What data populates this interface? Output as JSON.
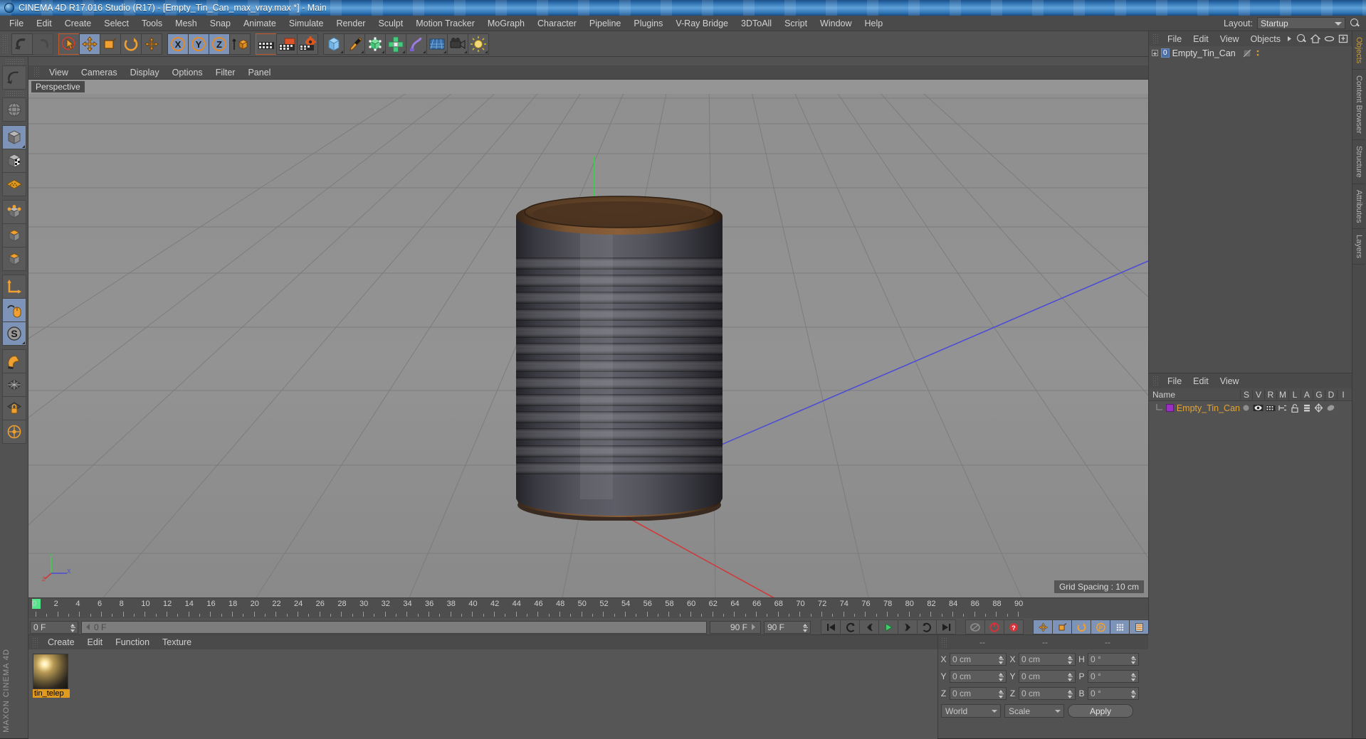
{
  "window": {
    "title": "CINEMA 4D R17.016 Studio (R17) - [Empty_Tin_Can_max_vray.max *] - Main",
    "app_icon": "cinema4d-logo-icon"
  },
  "menubar": {
    "items": [
      "File",
      "Edit",
      "Create",
      "Select",
      "Tools",
      "Mesh",
      "Snap",
      "Animate",
      "Simulate",
      "Render",
      "Sculpt",
      "Motion Tracker",
      "MoGraph",
      "Character",
      "Pipeline",
      "Plugins",
      "V-Ray Bridge",
      "3DToAll",
      "Script",
      "Window",
      "Help"
    ],
    "layout_label": "Layout:",
    "layout_value": "Startup",
    "search_icon": "magnifier-icon"
  },
  "toolbar": {
    "groups": [
      {
        "name": "undo-redo",
        "buttons": [
          {
            "icon": "undo-icon",
            "label": "Undo",
            "state": "normal"
          },
          {
            "icon": "redo-icon",
            "label": "Redo",
            "state": "disabled"
          }
        ]
      },
      {
        "name": "transform-tools",
        "buttons": [
          {
            "icon": "live-selection-icon",
            "label": "Live Selection",
            "state": "active"
          },
          {
            "icon": "move-icon",
            "label": "Move",
            "state": "selected"
          },
          {
            "icon": "scale-icon",
            "label": "Scale",
            "state": "normal"
          },
          {
            "icon": "rotate-icon",
            "label": "Rotate",
            "state": "normal"
          },
          {
            "icon": "move-alt-icon",
            "label": "Move",
            "state": "normal"
          }
        ]
      },
      {
        "name": "axis-locks",
        "buttons": [
          {
            "icon": "x-axis-icon",
            "label": "X Axis",
            "state": "selected"
          },
          {
            "icon": "y-axis-icon",
            "label": "Y Axis",
            "state": "selected"
          },
          {
            "icon": "z-axis-icon",
            "label": "Z Axis",
            "state": "selected"
          },
          {
            "icon": "world-object-axis-icon",
            "label": "World / Object",
            "state": "normal"
          }
        ]
      },
      {
        "name": "render-tools",
        "buttons": [
          {
            "icon": "render-view-icon",
            "label": "Render View",
            "state": "active"
          },
          {
            "icon": "render-region-icon",
            "label": "Render to Picture Viewer",
            "state": "normal"
          },
          {
            "icon": "render-settings-icon",
            "label": "Edit Render Settings",
            "state": "normal"
          }
        ]
      },
      {
        "name": "create-tools",
        "buttons": [
          {
            "icon": "cube-primitive-icon",
            "label": "Add Cube Object",
            "state": "normal"
          },
          {
            "icon": "spline-pen-icon",
            "label": "Pen",
            "state": "normal"
          },
          {
            "icon": "nurbs-icon",
            "label": "Subdivision Surface",
            "state": "normal"
          },
          {
            "icon": "array-icon",
            "label": "Array",
            "state": "normal"
          },
          {
            "icon": "deformer-icon",
            "label": "Bend Deformer",
            "state": "normal"
          },
          {
            "icon": "environment-icon",
            "label": "Floor",
            "state": "normal"
          },
          {
            "icon": "camera-icon",
            "label": "Camera",
            "state": "normal"
          },
          {
            "icon": "light-icon",
            "label": "Light",
            "state": "normal"
          }
        ]
      }
    ]
  },
  "left_toolbar": {
    "buttons": [
      {
        "icon": "undo-arrow-icon",
        "label": "Undo",
        "state": "normal"
      },
      {
        "icon": "globe-wireframe-icon",
        "label": "Make Editable",
        "state": "normal"
      },
      {
        "icon": "model-mode-icon",
        "label": "Model Mode",
        "state": "selected"
      },
      {
        "icon": "texture-mode-icon",
        "label": "Texture Mode",
        "state": "normal"
      },
      {
        "icon": "workplane-icon",
        "label": "Workplane",
        "state": "normal"
      },
      {
        "icon": "points-mode-icon",
        "label": "Points",
        "state": "normal"
      },
      {
        "icon": "edges-mode-icon",
        "label": "Edges",
        "state": "normal"
      },
      {
        "icon": "polygons-mode-icon",
        "label": "Polygons",
        "state": "normal"
      },
      {
        "icon": "axis-modify-icon",
        "label": "Enable Axis Modification",
        "state": "normal"
      },
      {
        "icon": "mouse-viewport-icon",
        "label": "Viewport Solo",
        "state": "selected"
      },
      {
        "icon": "snap-icon",
        "label": "Enable Snapping",
        "state": "selected"
      },
      {
        "icon": "magnet-icon",
        "label": "Magnet",
        "state": "normal"
      },
      {
        "icon": "workplane-grid-icon",
        "label": "Workplane Grid",
        "state": "normal"
      },
      {
        "icon": "lock-workplane-icon",
        "label": "Lock Workplane",
        "state": "normal"
      },
      {
        "icon": "planar-workplane-icon",
        "label": "Planar Workplane",
        "state": "normal"
      }
    ],
    "brand_line1": "MAXON",
    "brand_line2": "CINEMA 4D"
  },
  "viewport": {
    "menu": [
      "View",
      "Cameras",
      "Display",
      "Options",
      "Filter",
      "Panel"
    ],
    "label": "Perspective",
    "grid_spacing": "Grid Spacing : 10 cm",
    "axis_gizmo": {
      "x": "X",
      "y": "Y",
      "z": "Z"
    },
    "object": "tin-can-3d-model"
  },
  "timeline": {
    "ticks": [
      0,
      2,
      4,
      6,
      8,
      10,
      12,
      14,
      16,
      18,
      20,
      22,
      24,
      26,
      28,
      30,
      32,
      34,
      36,
      38,
      40,
      42,
      44,
      46,
      48,
      50,
      52,
      54,
      56,
      58,
      60,
      62,
      64,
      66,
      68,
      70,
      72,
      74,
      76,
      78,
      80,
      82,
      84,
      86,
      88,
      90
    ],
    "current_frame_field": "0 F",
    "trackbar_value": "0 F",
    "preview_end": "90 F",
    "doc_end": "90 F",
    "right_frame_field": "0 F",
    "playback_buttons": [
      {
        "icon": "go-to-start-icon",
        "label": "Go to Start"
      },
      {
        "icon": "step-back-keyframe-icon",
        "label": "Go to Previous Key"
      },
      {
        "icon": "step-back-frame-icon",
        "label": "Go to Previous Frame"
      },
      {
        "icon": "play-forward-icon",
        "label": "Play Forwards"
      },
      {
        "icon": "step-forward-frame-icon",
        "label": "Go to Next Frame"
      },
      {
        "icon": "step-forward-keyframe-icon",
        "label": "Go to Next Key"
      },
      {
        "icon": "go-to-end-icon",
        "label": "Go to End"
      }
    ],
    "record_buttons": [
      {
        "icon": "autokey-icon",
        "label": "Autokeying"
      },
      {
        "icon": "record-active-objects-icon",
        "label": "Record Active Objects"
      },
      {
        "icon": "keyframe-selection-icon",
        "label": "Keyframe Selection"
      }
    ],
    "param_buttons": [
      {
        "icon": "position-key-icon",
        "label": "Position"
      },
      {
        "icon": "scale-key-icon",
        "label": "Scale"
      },
      {
        "icon": "rotation-key-icon",
        "label": "Rotation"
      },
      {
        "icon": "pla-key-icon",
        "label": "Point Level Animation"
      },
      {
        "icon": "param-key-icon",
        "label": "Parameter"
      },
      {
        "icon": "timeline-icon",
        "label": "Timeline"
      }
    ]
  },
  "material_manager": {
    "menu": [
      "Create",
      "Edit",
      "Function",
      "Texture"
    ],
    "materials": [
      {
        "name": "tin_telep",
        "icon": "material-sphere-preview"
      }
    ]
  },
  "coordinate_manager": {
    "headers": [
      "--",
      "--",
      "--"
    ],
    "rows": [
      {
        "pos_label": "X",
        "pos_value": "0 cm",
        "size_label": "X",
        "size_value": "0 cm",
        "rot_label": "H",
        "rot_value": "0 °"
      },
      {
        "pos_label": "Y",
        "pos_value": "0 cm",
        "size_label": "Y",
        "size_value": "0 cm",
        "rot_label": "P",
        "rot_value": "0 °"
      },
      {
        "pos_label": "Z",
        "pos_value": "0 cm",
        "size_label": "Z",
        "size_value": "0 cm",
        "rot_label": "B",
        "rot_value": "0 °"
      }
    ],
    "coord_system": "World",
    "size_mode": "Scale",
    "apply_label": "Apply"
  },
  "object_manager": {
    "menu": [
      "File",
      "Edit",
      "View",
      "Objects"
    ],
    "header_icons": [
      "overflow-arrow-icon",
      "search-icon",
      "home-icon",
      "link-icon",
      "fit-icon"
    ],
    "rows": [
      {
        "name": "Empty_Tin_Can",
        "badge": "0",
        "expandable": true
      }
    ]
  },
  "attribute_manager": {
    "menu": [
      "File",
      "Edit",
      "View"
    ],
    "columns": [
      "Name",
      "S",
      "V",
      "R",
      "M",
      "L",
      "A",
      "G",
      "D",
      "I"
    ],
    "rows": [
      {
        "name": "Empty_Tin_Can",
        "swatch_color": "#9b2fc4",
        "icons": [
          "dot-icon",
          "eye-icon",
          "render-icon",
          "multipass-icon",
          "lock-open-icon",
          "layer-icon",
          "generator-icon",
          "deformer-icon"
        ]
      }
    ]
  },
  "side_tabs": [
    {
      "label": "Objects",
      "color": "#c89a3a"
    },
    {
      "label": "Content Browser",
      "color": "#b5b5b5"
    },
    {
      "label": "Structure",
      "color": "#b5b5b5"
    },
    {
      "label": "Attributes",
      "color": "#b5b5b5"
    },
    {
      "label": "Layers",
      "color": "#b5b5b5"
    }
  ],
  "colors": {
    "panel_bg": "#525252",
    "menu_bg": "#4a4a4a",
    "accent_selected": "#7d93b8",
    "accent_orange": "#e09a20",
    "viewport_bg": "#8c8c8c",
    "title_blue": "#2e6fae"
  }
}
